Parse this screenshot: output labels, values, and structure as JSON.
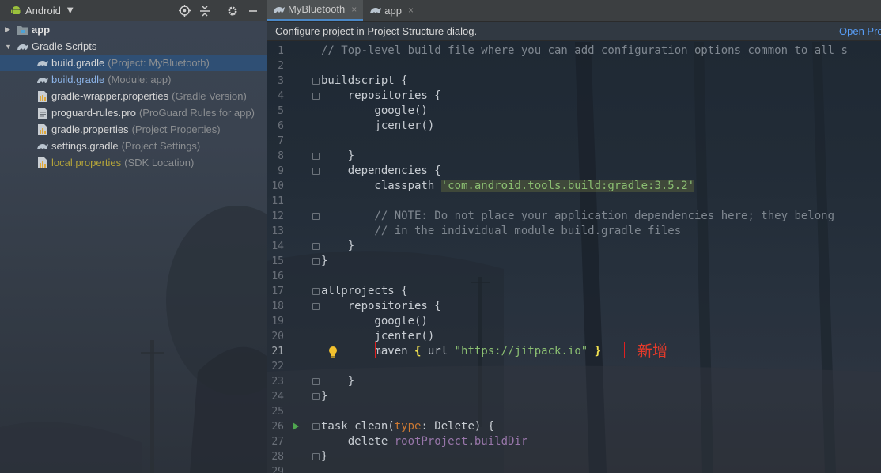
{
  "left_panel": {
    "view_selector": "Android",
    "icons": [
      "locate-icon",
      "collapse-icon",
      "gear-icon",
      "minimize-icon"
    ],
    "tree": [
      {
        "name": "app",
        "hint": "",
        "level": 0,
        "expanded": false,
        "icon": "folder-icon",
        "style": "bold"
      },
      {
        "name": "Gradle Scripts",
        "hint": "",
        "level": 0,
        "expanded": true,
        "icon": "gradle-icon",
        "style": "normal"
      },
      {
        "name": "build.gradle",
        "hint": "(Project: MyBluetooth)",
        "level": 1,
        "icon": "gradle-icon",
        "style": "normal",
        "selected": true
      },
      {
        "name": "build.gradle",
        "hint": "(Module: app)",
        "level": 1,
        "icon": "gradle-icon",
        "style": "blue"
      },
      {
        "name": "gradle-wrapper.properties",
        "hint": "(Gradle Version)",
        "level": 1,
        "icon": "properties-icon",
        "style": "normal"
      },
      {
        "name": "proguard-rules.pro",
        "hint": "(ProGuard Rules for app)",
        "level": 1,
        "icon": "file-icon",
        "style": "normal"
      },
      {
        "name": "gradle.properties",
        "hint": "(Project Properties)",
        "level": 1,
        "icon": "properties-icon",
        "style": "normal"
      },
      {
        "name": "settings.gradle",
        "hint": "(Project Settings)",
        "level": 1,
        "icon": "gradle-icon",
        "style": "normal"
      },
      {
        "name": "local.properties",
        "hint": "(SDK Location)",
        "level": 1,
        "icon": "properties-icon",
        "style": "olive"
      }
    ]
  },
  "editor": {
    "tabs": [
      {
        "label": "MyBluetooth",
        "active": true,
        "close": "×"
      },
      {
        "label": "app",
        "active": false,
        "close": "×"
      }
    ],
    "notice": {
      "text": "Configure project in Project Structure dialog.",
      "link": "Open Pro"
    },
    "annotation": "新增",
    "lines": [
      [
        {
          "t": "// Top-level build file where you can add configuration options common to all s",
          "c": "c-comment"
        }
      ],
      [],
      [
        {
          "t": "buildscript {",
          "c": ""
        }
      ],
      [
        {
          "t": "    repositories {",
          "c": ""
        }
      ],
      [
        {
          "t": "        google()",
          "c": ""
        }
      ],
      [
        {
          "t": "        jcenter()",
          "c": ""
        }
      ],
      [],
      [
        {
          "t": "    }",
          "c": ""
        }
      ],
      [
        {
          "t": "    dependencies {",
          "c": ""
        }
      ],
      [
        {
          "t": "        classpath ",
          "c": ""
        },
        {
          "t": "'com.android.tools.build:gradle:3.5.2'",
          "c": "c-str-hl"
        }
      ],
      [],
      [
        {
          "t": "        // NOTE: Do not place your application dependencies here; they belong",
          "c": "c-comment"
        }
      ],
      [
        {
          "t": "        // in the individual module build.gradle files",
          "c": "c-comment"
        }
      ],
      [
        {
          "t": "    }",
          "c": ""
        }
      ],
      [
        {
          "t": "}",
          "c": ""
        }
      ],
      [],
      [
        {
          "t": "allprojects {",
          "c": ""
        }
      ],
      [
        {
          "t": "    repositories {",
          "c": ""
        }
      ],
      [
        {
          "t": "        google()",
          "c": ""
        }
      ],
      [
        {
          "t": "        jcenter()",
          "c": ""
        }
      ],
      [
        {
          "t": "        maven ",
          "c": ""
        },
        {
          "t": "{",
          "c": "c-brace-hl"
        },
        {
          "t": " url ",
          "c": ""
        },
        {
          "t": "\"https://jitpack.io\"",
          "c": "c-str"
        },
        {
          "t": " ",
          "c": ""
        },
        {
          "t": "}",
          "c": "c-brace-hl"
        }
      ],
      [],
      [
        {
          "t": "    }",
          "c": ""
        }
      ],
      [
        {
          "t": "}",
          "c": ""
        }
      ],
      [],
      [
        {
          "t": "task clean(",
          "c": ""
        },
        {
          "t": "type",
          "c": "c-kw"
        },
        {
          "t": ": Delete) {",
          "c": ""
        }
      ],
      [
        {
          "t": "    delete ",
          "c": ""
        },
        {
          "t": "rootProject",
          "c": "c-purple"
        },
        {
          "t": ".",
          "c": ""
        },
        {
          "t": "buildDir",
          "c": "c-purple"
        }
      ],
      [
        {
          "t": "}",
          "c": ""
        }
      ],
      []
    ],
    "current_line": 21
  }
}
